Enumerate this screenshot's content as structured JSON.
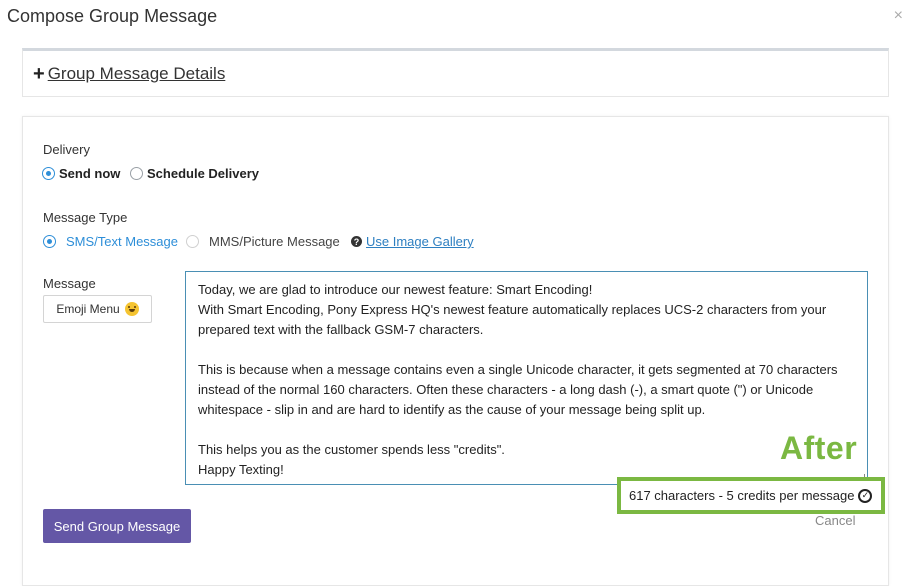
{
  "dialog": {
    "title": "Compose Group Message",
    "close_icon": "×"
  },
  "details": {
    "label": "Group Message Details",
    "plus_icon": "+"
  },
  "delivery": {
    "label": "Delivery",
    "options": [
      {
        "label": "Send now",
        "checked": true
      },
      {
        "label": "Schedule Delivery",
        "checked": false
      }
    ]
  },
  "message_type": {
    "label": "Message Type",
    "options": [
      {
        "label": "SMS/Text Message",
        "checked": true
      },
      {
        "label": "MMS/Picture Message",
        "checked": false
      }
    ],
    "help_icon": "?",
    "gallery_link": "Use Image Gallery"
  },
  "message": {
    "label": "Message",
    "emoji_button": "Emoji Menu",
    "lines": [
      "Today, we are glad to introduce our newest feature: Smart Encoding!",
      "With Smart Encoding, Pony Express HQ's newest feature automatically replaces UCS-2 characters from your",
      "prepared text with the fallback GSM-7 characters.",
      "",
      "This is because when a message contains even a single Unicode character, it gets segmented at 70 characters",
      "instead of the normal 160 characters. Often these characters - a long dash (-), a smart quote (\") or Unicode",
      "whitespace - slip in and are hard to identify as the cause of your message being split up.",
      "",
      "This helps you as the customer spends less \"credits\".",
      "Happy Texting!"
    ]
  },
  "annotation": {
    "after_label": "After"
  },
  "counter": {
    "text": "617 characters - 5 credits per message",
    "check_icon": "✓"
  },
  "actions": {
    "cancel": "Cancel",
    "send": "Send Group Message"
  },
  "colors": {
    "accent_blue": "#2d8ed8",
    "send_button": "#6457a6",
    "highlight_green": "#7bb842"
  }
}
